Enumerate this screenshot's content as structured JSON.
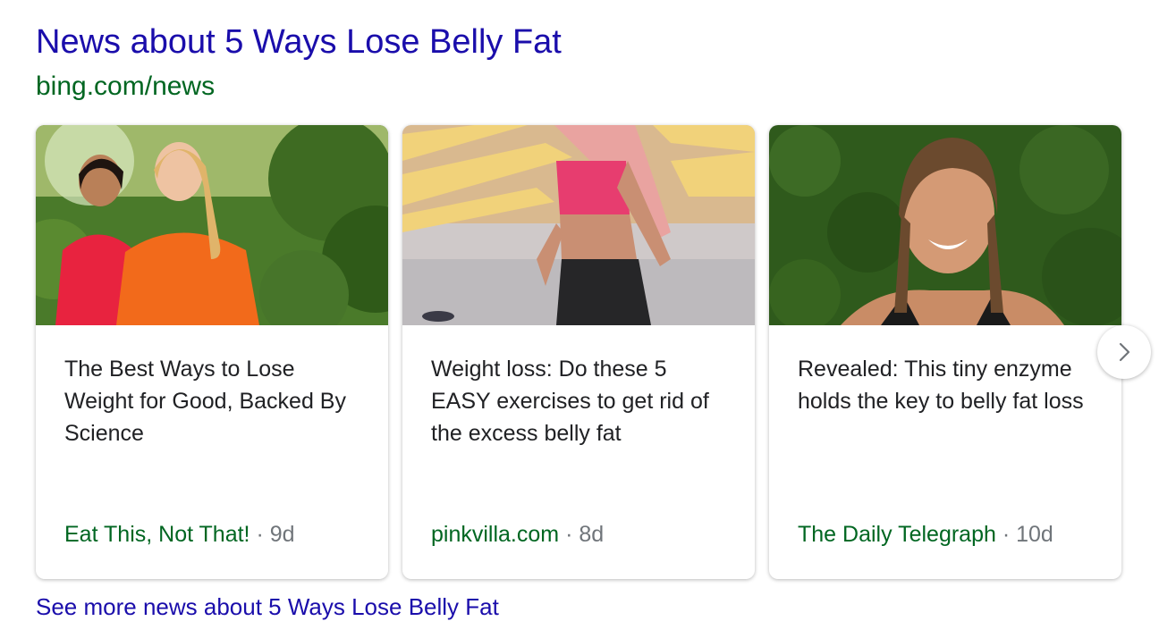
{
  "header": {
    "title": "News about 5 Ways Lose Belly Fat",
    "source_url": "bing.com/news"
  },
  "cards": [
    {
      "headline": "The Best Ways to Lose Weight for Good, Backed By Science",
      "publisher": "Eat This, Not That!",
      "separator": "·",
      "age": "9d",
      "image_icon": "two-women-walking-image"
    },
    {
      "headline": "Weight loss: Do these 5 EASY exercises to get rid of the excess belly fat",
      "publisher": "pinkvilla.com",
      "separator": "·",
      "age": "8d",
      "image_icon": "woman-running-image"
    },
    {
      "headline": "Revealed: This tiny enzyme holds the key to belly fat loss",
      "publisher": "The Daily Telegraph",
      "separator": "·",
      "age": "10d",
      "image_icon": "smiling-woman-portrait-image"
    }
  ],
  "carousel": {
    "next_icon": "chevron-right-icon"
  },
  "footer": {
    "see_more": "See more news about 5 Ways Lose Belly Fat"
  },
  "colors": {
    "link_blue": "#1a0dab",
    "url_green": "#006621",
    "meta_gray": "#70757a",
    "text": "#202124"
  }
}
